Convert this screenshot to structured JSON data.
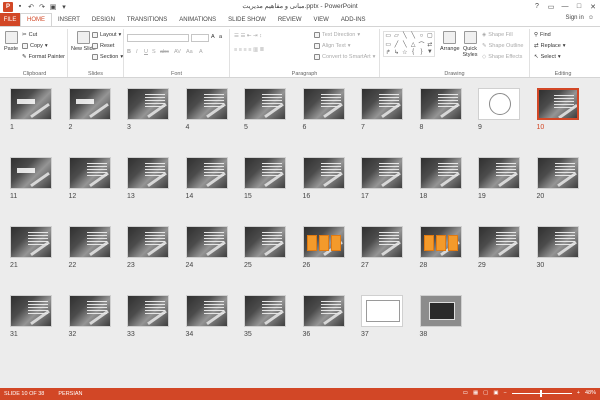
{
  "title_bar": {
    "document_title": "مبانی و مفاهیم مدیریت.pptx - PowerPoint",
    "app_icon_letter": "P",
    "qat_icons": [
      "save-icon",
      "undo-icon",
      "redo-icon",
      "slideshow-icon",
      "customize-icon"
    ],
    "window_controls": [
      "?",
      "▭",
      "—",
      "□",
      "✕"
    ]
  },
  "tabs": {
    "file": "FILE",
    "items": [
      "HOME",
      "INSERT",
      "DESIGN",
      "TRANSITIONS",
      "ANIMATIONS",
      "SLIDE SHOW",
      "REVIEW",
      "VIEW",
      "ADD-INS"
    ],
    "active": "HOME",
    "sign_in": "Sign in"
  },
  "ribbon": {
    "clipboard": {
      "label": "Clipboard",
      "paste": "Paste",
      "cut": "Cut",
      "copy": "Copy",
      "format_painter": "Format Painter"
    },
    "slides": {
      "label": "Slides",
      "new_slide": "New Slide",
      "layout": "Layout",
      "reset": "Reset",
      "section": "Section"
    },
    "font": {
      "label": "Font",
      "bold": "B",
      "italic": "I",
      "underline": "U",
      "shadow": "S",
      "strike": "abc",
      "spacing": "AV",
      "case": "Aa",
      "color": "A"
    },
    "paragraph": {
      "label": "Paragraph",
      "text_direction": "Text Direction",
      "align_text": "Align Text",
      "convert_smartart": "Convert to SmartArt"
    },
    "drawing": {
      "label": "Drawing",
      "arrange": "Arrange",
      "quick_styles": "Quick Styles",
      "shape_fill": "Shape Fill",
      "shape_outline": "Shape Outline",
      "shape_effects": "Shape Effects",
      "shapes": [
        "▭",
        "▱",
        "╲",
        "╲",
        "○",
        "▢",
        "▭",
        "╱",
        "╲",
        "△",
        "⌒",
        "⇄",
        "↱",
        "↳",
        "☆",
        "{",
        "}",
        "▼"
      ]
    },
    "editing": {
      "label": "Editing",
      "find": "Find",
      "replace": "Replace",
      "select": "Select"
    }
  },
  "slides": {
    "selected": 10,
    "items": [
      {
        "n": "1",
        "kind": "title"
      },
      {
        "n": "2",
        "kind": "title"
      },
      {
        "n": "3",
        "kind": "text"
      },
      {
        "n": "4",
        "kind": "text"
      },
      {
        "n": "5",
        "kind": "text"
      },
      {
        "n": "6",
        "kind": "text"
      },
      {
        "n": "7",
        "kind": "text"
      },
      {
        "n": "8",
        "kind": "text"
      },
      {
        "n": "9",
        "kind": "circle"
      },
      {
        "n": "10",
        "kind": "text"
      },
      {
        "n": "11",
        "kind": "title"
      },
      {
        "n": "12",
        "kind": "text"
      },
      {
        "n": "13",
        "kind": "text"
      },
      {
        "n": "14",
        "kind": "text"
      },
      {
        "n": "15",
        "kind": "text"
      },
      {
        "n": "16",
        "kind": "text"
      },
      {
        "n": "17",
        "kind": "text"
      },
      {
        "n": "18",
        "kind": "text"
      },
      {
        "n": "19",
        "kind": "text"
      },
      {
        "n": "20",
        "kind": "text"
      },
      {
        "n": "21",
        "kind": "text"
      },
      {
        "n": "22",
        "kind": "text"
      },
      {
        "n": "23",
        "kind": "text"
      },
      {
        "n": "24",
        "kind": "text"
      },
      {
        "n": "25",
        "kind": "text"
      },
      {
        "n": "26",
        "kind": "orange"
      },
      {
        "n": "27",
        "kind": "text"
      },
      {
        "n": "28",
        "kind": "orange"
      },
      {
        "n": "29",
        "kind": "text"
      },
      {
        "n": "30",
        "kind": "text"
      },
      {
        "n": "31",
        "kind": "text"
      },
      {
        "n": "32",
        "kind": "text"
      },
      {
        "n": "33",
        "kind": "text"
      },
      {
        "n": "34",
        "kind": "text"
      },
      {
        "n": "35",
        "kind": "text"
      },
      {
        "n": "36",
        "kind": "text"
      },
      {
        "n": "37",
        "kind": "box"
      },
      {
        "n": "38",
        "kind": "laptop"
      }
    ]
  },
  "status_bar": {
    "slide_info": "SLIDE 10 OF 38",
    "language": "PERSIAN",
    "zoom": "48%",
    "zoom_fraction": 0.48
  },
  "colors": {
    "accent": "#d24726",
    "sorter_bg": "#ececec"
  }
}
